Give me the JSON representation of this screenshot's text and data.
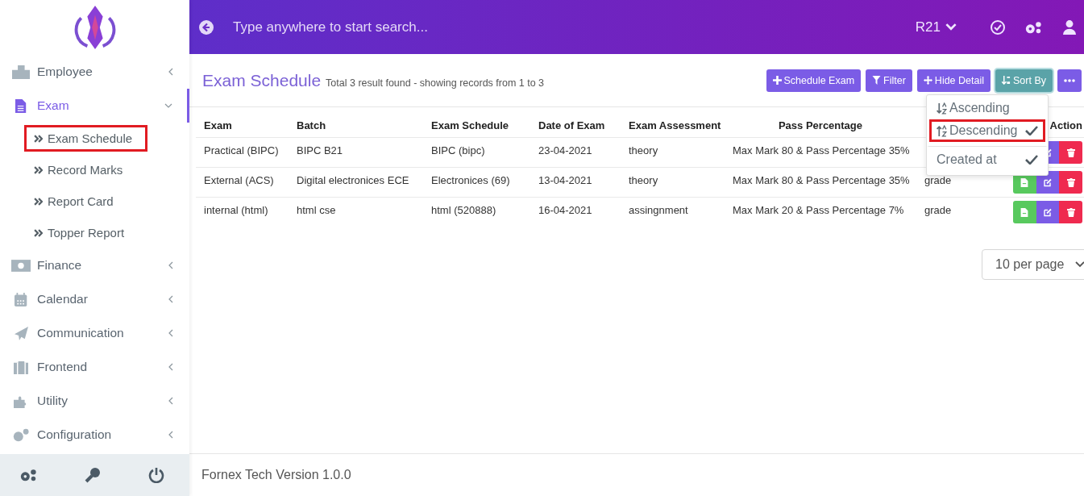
{
  "topbar": {
    "search_placeholder": "Type anywhere to start search...",
    "session": "R21"
  },
  "sidebar": {
    "items": [
      {
        "label": "Employee",
        "expanded": false,
        "selected": false
      },
      {
        "label": "Exam",
        "expanded": true,
        "selected": true,
        "children": [
          {
            "label": "Exam Schedule",
            "annotated": true
          },
          {
            "label": "Record Marks",
            "annotated": false
          },
          {
            "label": "Report Card",
            "annotated": false
          },
          {
            "label": "Topper Report",
            "annotated": false
          }
        ]
      },
      {
        "label": "Finance",
        "expanded": false,
        "selected": false
      },
      {
        "label": "Calendar",
        "expanded": false,
        "selected": false
      },
      {
        "label": "Communication",
        "expanded": false,
        "selected": false
      },
      {
        "label": "Frontend",
        "expanded": false,
        "selected": false
      },
      {
        "label": "Utility",
        "expanded": false,
        "selected": false
      },
      {
        "label": "Configuration",
        "expanded": false,
        "selected": false
      }
    ]
  },
  "page": {
    "title": "Exam Schedule",
    "summary": "Total 3 result found - showing records from 1 to 3",
    "toolbar": [
      {
        "label": "Schedule Exam",
        "expanded": false
      },
      {
        "label": "Filter",
        "expanded": false
      },
      {
        "label": "Hide Detail",
        "expanded": false
      },
      {
        "label": "Sort By",
        "expanded": true
      }
    ],
    "sort_menu": [
      {
        "label": "Ascending",
        "kind": "order",
        "divider_before": false,
        "checked": false,
        "annotated": false
      },
      {
        "label": "Descending",
        "kind": "order",
        "divider_before": false,
        "checked": true,
        "annotated": true
      },
      {
        "label": "Created at",
        "kind": "field",
        "divider_before": true,
        "checked": true,
        "annotated": false
      }
    ],
    "table": {
      "columns": [
        "Exam",
        "Batch",
        "Exam Schedule",
        "Date of Exam",
        "Exam Assessment",
        "Pass Percentage",
        "",
        "Action"
      ],
      "rows": [
        [
          "Practical (BIPC)",
          "BIPC B21",
          "BIPC (bipc)",
          "23-04-2021",
          "theory",
          "Max Mark 80 & Pass Percentage 35%"
        ],
        [
          "External (ACS)",
          "Digital electronices ECE",
          "Electronices (69)",
          "13-04-2021",
          "theory",
          "Max Mark 80 & Pass Percentage 35%",
          "grade"
        ],
        [
          "internal (html)",
          "html cse",
          "html (520888)",
          "16-04-2021",
          "assingnment",
          "Max Mark 20 & Pass Percentage 7%",
          "grade"
        ]
      ]
    },
    "per_page": "10 per page"
  },
  "footer": "Fornex Tech Version 1.0.0"
}
